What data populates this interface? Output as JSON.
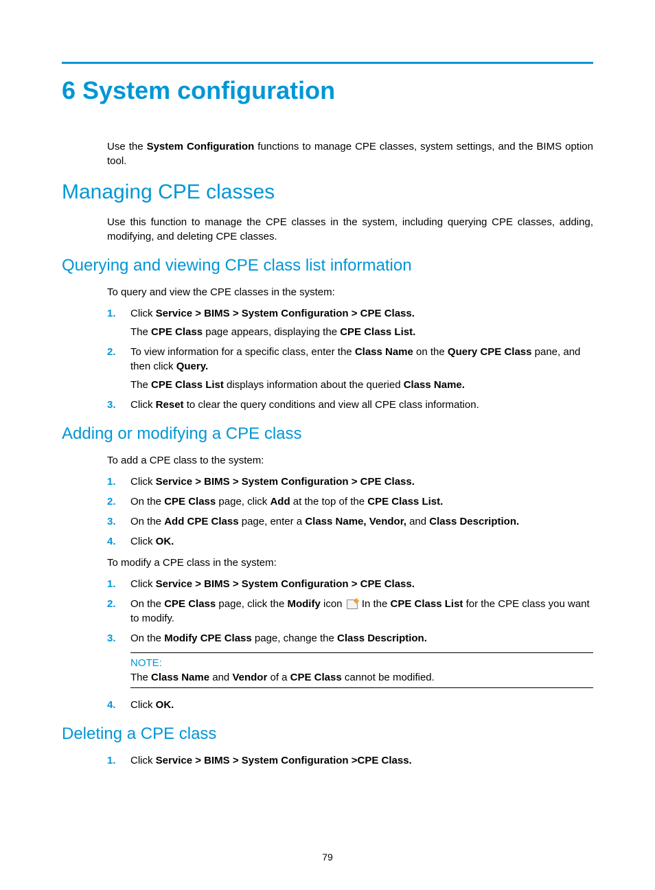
{
  "chapter_title": "6 System configuration",
  "intro": {
    "pre": "Use the ",
    "b1": "System Configuration",
    "post": " functions to manage CPE classes, system settings, and the BIMS option tool."
  },
  "s1": {
    "title": "Managing CPE classes",
    "body": "Use this function to manage the CPE classes in the system, including querying CPE classes, adding, modifying, and deleting CPE classes."
  },
  "s2": {
    "title": "Querying and viewing CPE class list information",
    "lead": "To query and view the CPE classes in the system:",
    "step1": {
      "pre": "Click ",
      "b1": "Service > BIMS > System Configuration > CPE Class.",
      "sub_pre": "The ",
      "sub_b1": "CPE Class",
      "sub_mid": " page appears, displaying the ",
      "sub_b2": "CPE Class List."
    },
    "step2": {
      "pre": "To view information for a specific class, enter the ",
      "b1": "Class Name",
      "mid1": " on the ",
      "b2": "Query CPE Class",
      "mid2": " pane, and then click ",
      "b3": "Query.",
      "sub_pre": "The ",
      "sub_b1": "CPE Class List",
      "sub_mid": " displays information about the queried ",
      "sub_b2": "Class Name."
    },
    "step3": {
      "pre": "Click ",
      "b1": "Reset",
      "post": " to clear the query conditions and view all CPE class information."
    }
  },
  "s3": {
    "title": "Adding or modifying a CPE class",
    "lead1": "To add a CPE class to the system:",
    "a1": {
      "pre": "Click ",
      "b1": "Service > BIMS > System Configuration > CPE Class."
    },
    "a2": {
      "pre": "On the ",
      "b1": "CPE Class",
      "mid1": " page, click ",
      "b2": "Add",
      "mid2": " at the top of the ",
      "b3": "CPE Class List."
    },
    "a3": {
      "pre": "On the ",
      "b1": "Add CPE Class",
      "mid1": " page, enter a ",
      "b2": "Class Name, Vendor,",
      "mid2": " and ",
      "b3": "Class Description."
    },
    "a4": {
      "pre": "Click ",
      "b1": "OK."
    },
    "lead2": "To modify a CPE class in the system:",
    "m1": {
      "pre": "Click ",
      "b1": "Service > BIMS > System Configuration > CPE Class."
    },
    "m2": {
      "pre": "On the ",
      "b1": "CPE Class",
      "mid1": " page, click the ",
      "b2": "Modify",
      "mid2": " icon ",
      "mid3": " In the ",
      "b3": "CPE Class List",
      "post": " for the CPE class you want to modify."
    },
    "m3": {
      "pre": "On the ",
      "b1": "Modify CPE Class",
      "mid1": " page, change the ",
      "b2": "Class Description."
    },
    "note_label": "NOTE:",
    "note": {
      "pre": "The ",
      "b1": "Class Name",
      "mid1": " and ",
      "b2": "Vendor",
      "mid2": " of a ",
      "b3": "CPE Class",
      "post": " cannot be modified."
    },
    "m4": {
      "pre": "Click ",
      "b1": "OK."
    }
  },
  "s4": {
    "title": "Deleting a CPE class",
    "d1": {
      "pre": "Click ",
      "b1": "Service > BIMS > System Configuration >CPE Class."
    }
  },
  "page_number": "79",
  "nums": {
    "n1": "1.",
    "n2": "2.",
    "n3": "3.",
    "n4": "4."
  }
}
